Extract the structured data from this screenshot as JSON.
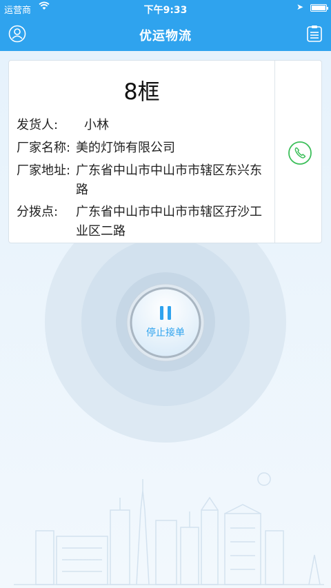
{
  "status_bar": {
    "carrier": "运营商",
    "time": "下午9:33"
  },
  "nav": {
    "title": "优运物流",
    "icons": {
      "left": "user-icon",
      "right": "order-list-icon"
    }
  },
  "order": {
    "count": "8框",
    "sender_label": "发货人:",
    "sender": "小林",
    "factory_name_label": "厂家名称:",
    "factory_name": "美的灯饰有限公司",
    "factory_address_label": "厂家地址:",
    "factory_address": "广东省中山市中山市市辖区东兴东路",
    "dispatch_point_label": "分拨点:",
    "dispatch_point": "广东省中山市中山市市辖区孖沙工业区二路",
    "phone_icon": "phone-icon"
  },
  "stop_button": {
    "label": "停止接单",
    "icon": "pause-icon"
  },
  "colors": {
    "primary": "#2fa3ee",
    "phone_green": "#3cbf5a",
    "background": "#e9f4fd"
  }
}
